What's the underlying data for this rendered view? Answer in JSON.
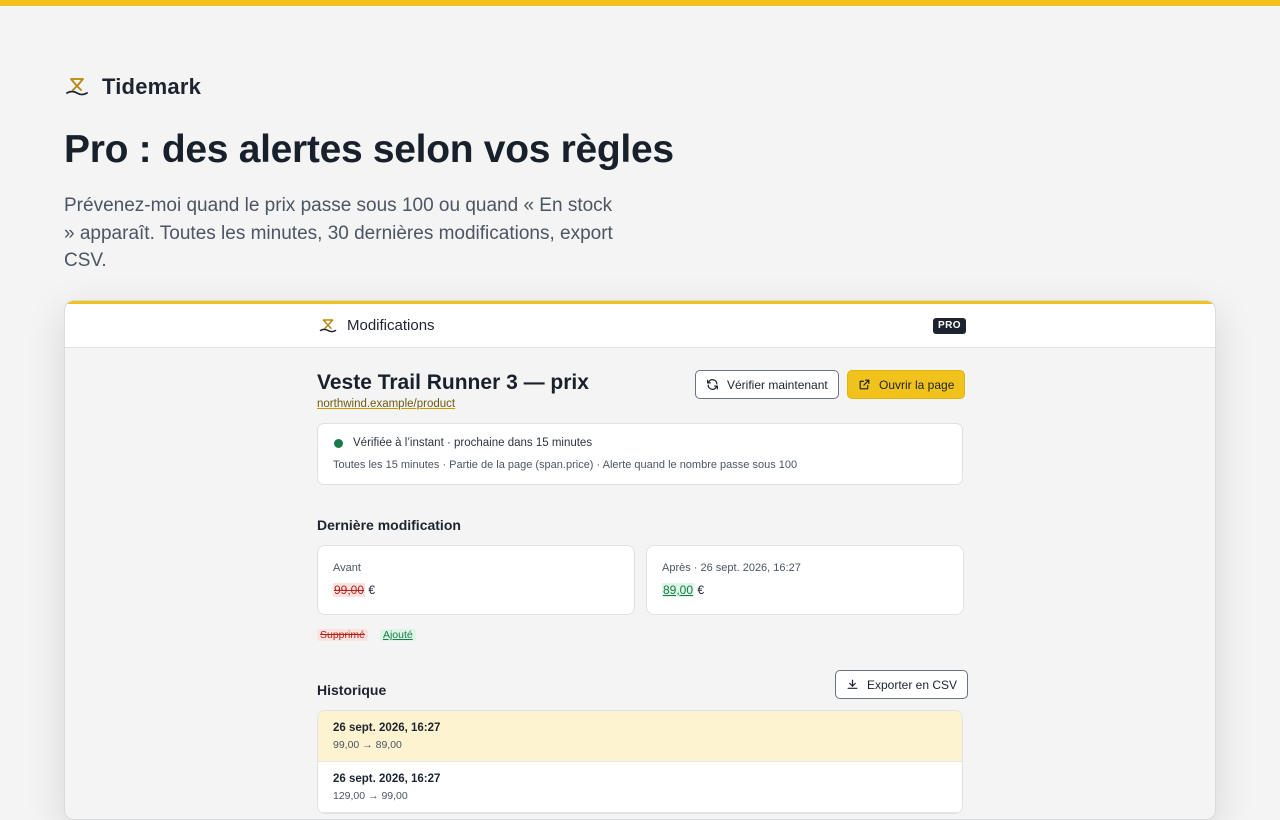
{
  "brand": {
    "name": "Tidemark",
    "logo_icon": "tide-logo-icon",
    "accent_color": "#f1c21b"
  },
  "hero": {
    "title": "Pro : des alertes selon vos règles",
    "subtitle": "Prévenez-moi quand le prix passe sous 100 ou quand « En stock » apparaît. Toutes les minutes, 30 dernières modifications, export CSV."
  },
  "panel": {
    "header": {
      "title": "Modifications",
      "badge": "PRO"
    },
    "item": {
      "title": "Veste Trail Runner 3 — prix",
      "url": "northwind.example/product"
    },
    "actions": {
      "verify_label": "Vérifier maintenant",
      "open_label": "Ouvrir la page",
      "export_label": "Exporter en CSV"
    },
    "status": {
      "line": "Vérifiée à l’instant · prochaine dans 15 minutes",
      "meta": "Toutes les 15 minutes · Partie de la page (span.price) · Alerte quand le nombre passe sous 100",
      "status_color": "#1a7a48"
    },
    "last_change": {
      "section_title": "Dernière modification",
      "before": {
        "label": "Avant",
        "value": "99,00",
        "unit": "€"
      },
      "after": {
        "label": "Après · 26 sept. 2026, 16:27",
        "value": "89,00",
        "unit": "€"
      },
      "legend": {
        "removed": "Supprimé",
        "added": "Ajouté"
      }
    },
    "history": {
      "section_title": "Historique",
      "rows": [
        {
          "date": "26 sept. 2026, 16:27",
          "change": "99,00 → 89,00"
        },
        {
          "date": "26 sept. 2026, 16:27",
          "change": "129,00 → 99,00"
        }
      ]
    }
  }
}
